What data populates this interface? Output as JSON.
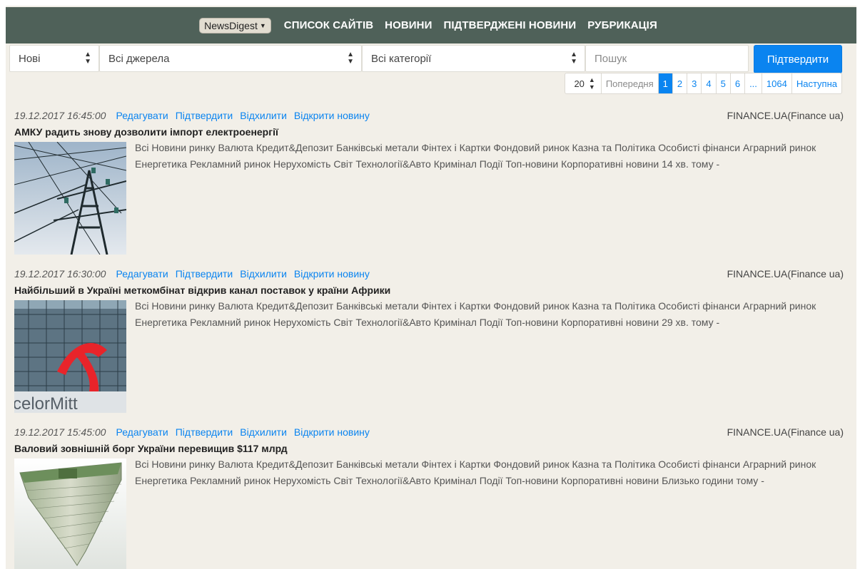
{
  "navbar": {
    "brand": "NewsDigest",
    "links": [
      "СПИСОК САЙТІВ",
      "НОВИНИ",
      "ПІДТВЕРДЖЕНІ НОВИНИ",
      "РУБРИКАЦІЯ"
    ]
  },
  "filters": {
    "status": "Нові",
    "source": "Всі джерела",
    "category": "Всі категорії",
    "search_placeholder": "Пошук",
    "confirm_label": "Підтвердити"
  },
  "pagination": {
    "per_page": "20",
    "prev": "Попередня",
    "pages": [
      "1",
      "2",
      "3",
      "4",
      "5",
      "6",
      "...",
      "1064"
    ],
    "active_page": "1",
    "next": "Наступна"
  },
  "actions": {
    "edit": "Редагувати",
    "confirm": "Підтвердити",
    "reject": "Відхилити",
    "open": "Відкрити новину"
  },
  "news": [
    {
      "date": "19.12.2017 16:45:00",
      "source": "FINANCE.UA(Finance ua)",
      "title": "АМКУ радить знову дозволити імпорт електроенергії",
      "summary": "Всі Новини ринку Валюта Кредит&Депозит Банківські метали Фінтех і Картки Фондовий ринок Казна та Політика Особисті фінанси Аграрний ринок Енергетика Рекламний ринок Нерухомість Світ Технології&Авто Кримінал Події Топ-новини Корпоративні новини 14 хв. тому -",
      "thumb": "power-lines-icon"
    },
    {
      "date": "19.12.2017 16:30:00",
      "source": "FINANCE.UA(Finance ua)",
      "title": "Найбільший в Україні меткомбінат відкрив канал поставок у країни Африки",
      "summary": "Всі Новини ринку Валюта Кредит&Депозит Банківські метали Фінтех і Картки Фондовий ринок Казна та Політика Особисті фінанси Аграрний ринок Енергетика Рекламний ринок Нерухомість Світ Технології&Авто Кримінал Події Топ-новини Корпоративні новини 29 хв. тому -",
      "thumb": "building-logo-icon"
    },
    {
      "date": "19.12.2017 15:45:00",
      "source": "FINANCE.UA(Finance ua)",
      "title": "Валовий зовнішній борг України перевищив $117 млрд",
      "summary": "Всі Новини ринку Валюта Кредит&Депозит Банківські метали Фінтех і Картки Фондовий ринок Казна та Політика Особисті фінанси Аграрний ринок Енергетика Рекламний ринок Нерухомість Світ Технології&Авто Кримінал Події Топ-новини Корпоративні новини Близько години тому -",
      "thumb": "money-stack-icon"
    }
  ]
}
